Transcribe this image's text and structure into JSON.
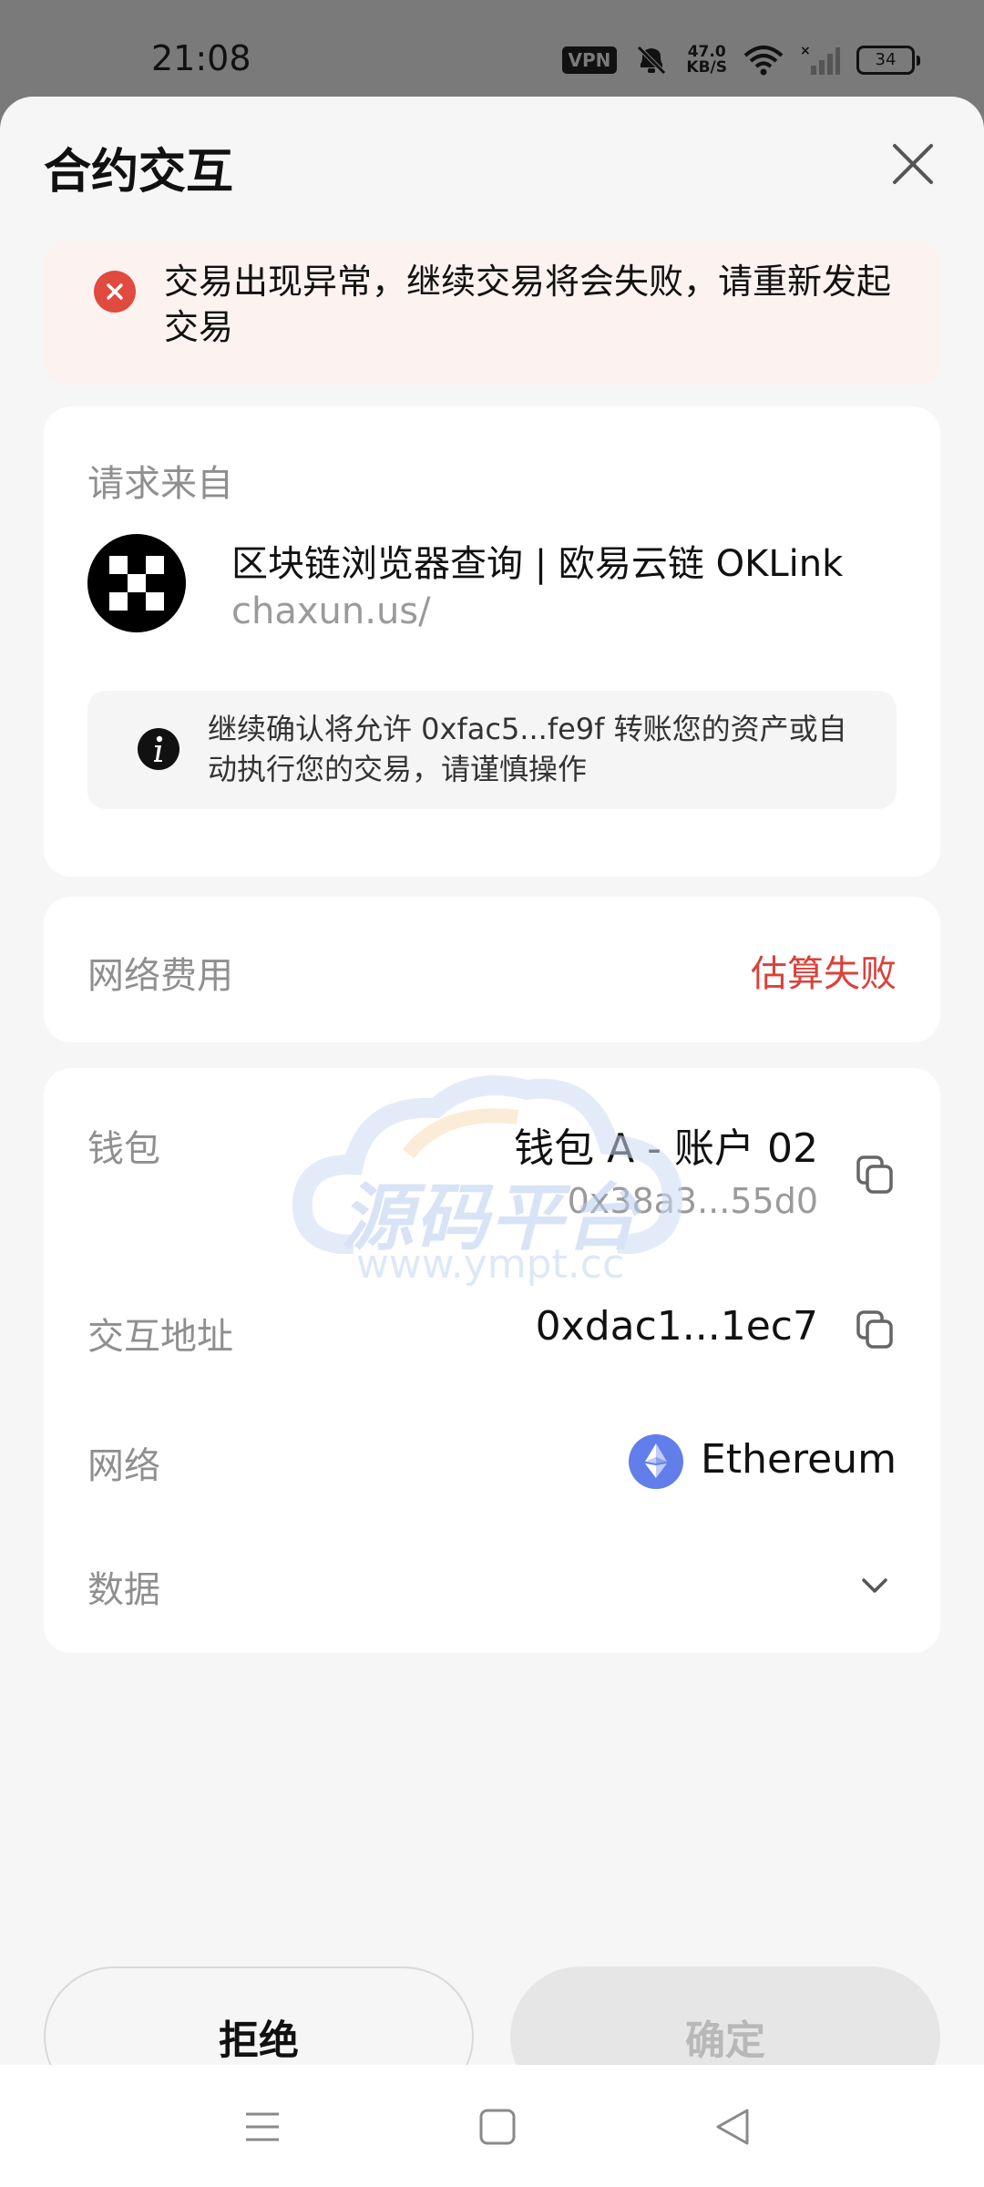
{
  "status_bar": {
    "time": "21:08",
    "vpn": "VPN",
    "speed_value": "47.0",
    "speed_unit": "KB/S",
    "battery": "34"
  },
  "sheet": {
    "title": "合约交互",
    "close_icon": "close-icon"
  },
  "error": {
    "text": "交易出现异常，继续交易将会失败，请重新发起交易",
    "color": "#e04a3f"
  },
  "source": {
    "label": "请求来自",
    "dapp_name": "区块链浏览器查询 | 欧易云链 OKLink",
    "dapp_url": "chaxun.us/",
    "info_text": "继续确认将允许 0xfac5...fe9f 转账您的资产或自动执行您的交易，请谨慎操作"
  },
  "fee": {
    "label": "网络费用",
    "value": "估算失败",
    "value_color": "#d9423a"
  },
  "details": {
    "wallet_label": "钱包",
    "wallet_name": "钱包 A - 账户 02",
    "wallet_address": "0x38a3...55d0",
    "interact_label": "交互地址",
    "interact_address": "0xdac1...1ec7",
    "network_label": "网络",
    "network_value": "Ethereum",
    "data_label": "数据"
  },
  "watermark": {
    "text": "源码平台",
    "url": "www.ympt.cc"
  },
  "actions": {
    "reject": "拒绝",
    "confirm": "确定"
  }
}
